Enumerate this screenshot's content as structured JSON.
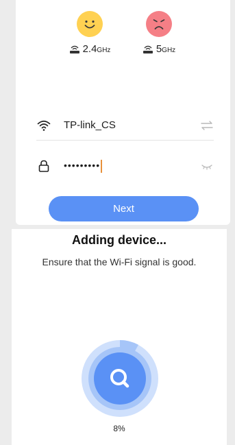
{
  "bands": {
    "band_24": {
      "value": "2.4",
      "unit": "GHz",
      "status_icon": "happy-face-icon",
      "color": "#ffd152"
    },
    "band_5": {
      "value": "5",
      "unit": "GHz",
      "status_icon": "sad-face-icon",
      "color": "#f57f86"
    }
  },
  "form": {
    "ssid": "TP-link_CS",
    "password_masked": "•••••••••",
    "next_label": "Next"
  },
  "adding": {
    "title": "Adding device...",
    "subtitle": "Ensure that the Wi-Fi signal is good.",
    "progress_text": "8%",
    "progress_fraction": 0.08
  },
  "colors": {
    "accent": "#5a91f5",
    "ring_light": "#cfe0fc",
    "ring_mid": "#a6c5f8",
    "ring_inner": "#5a91f5"
  }
}
